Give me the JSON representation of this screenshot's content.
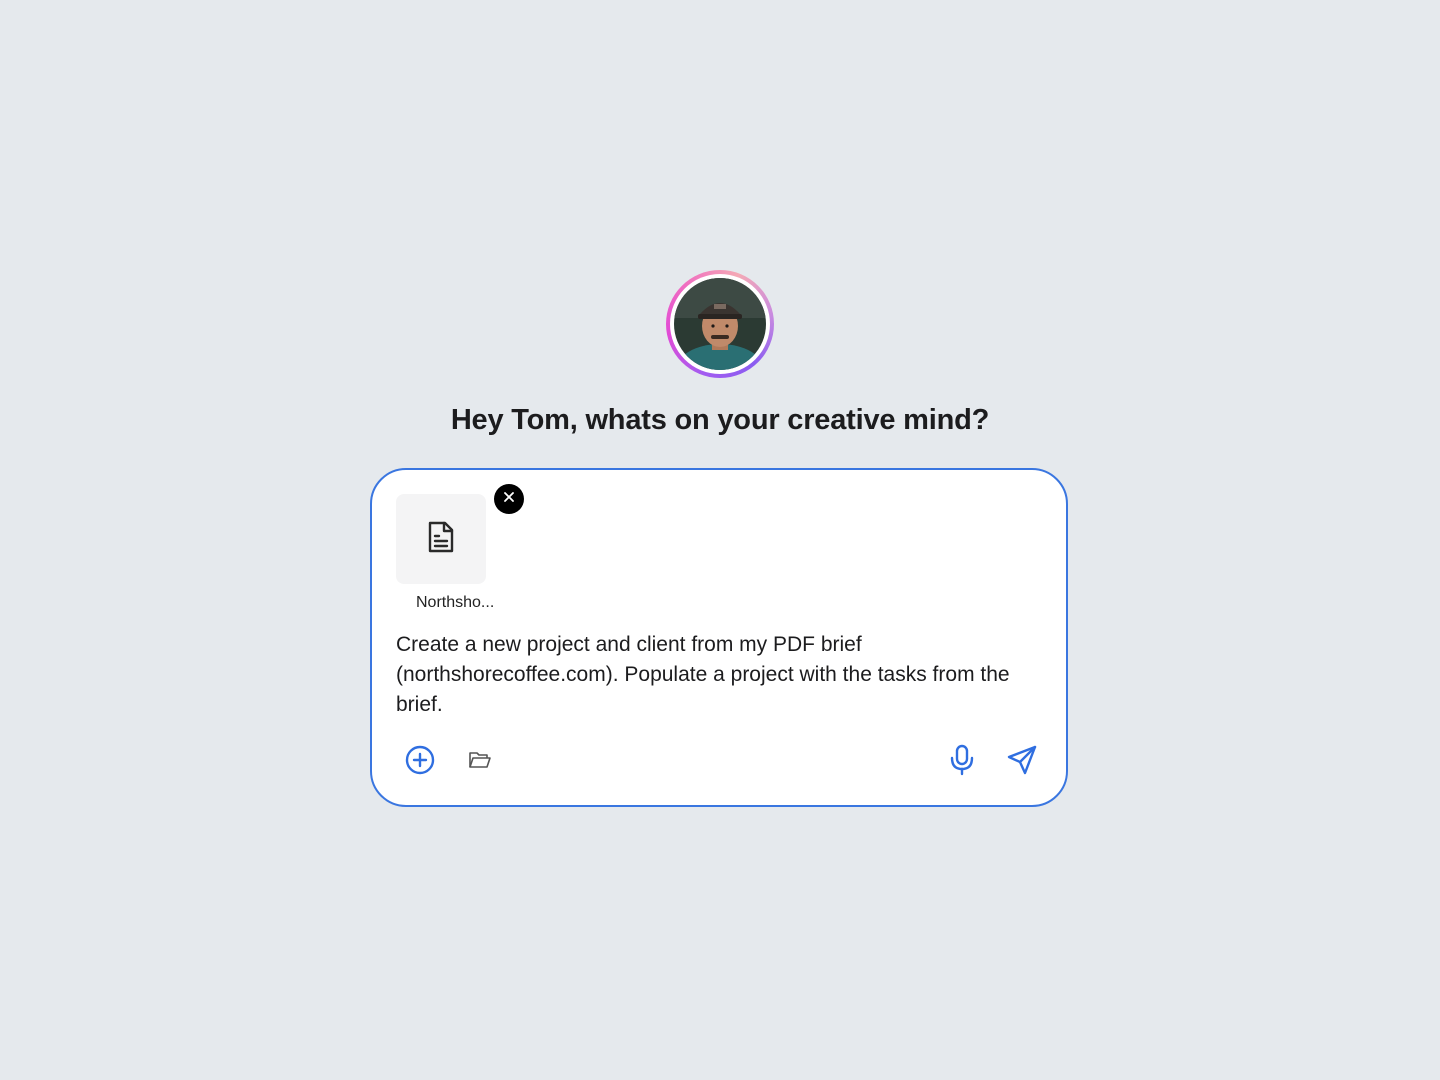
{
  "greeting": "Hey Tom, whats on your creative mind?",
  "user": {
    "avatar_icon": "user-avatar-photo"
  },
  "composer": {
    "attachment": {
      "name": "Northsho...",
      "icon": "document-icon"
    },
    "prompt_text": "Create a new project and client from my PDF brief (northshorecoffee.com). Populate a project with the tasks from the brief.",
    "toolbar": {
      "add_icon": "plus-circle-icon",
      "folder_icon": "folder-open-icon",
      "mic_icon": "microphone-icon",
      "send_icon": "send-icon"
    }
  },
  "colors": {
    "accent": "#3a76e0",
    "background": "#e5e9ed",
    "ring_gradient_start": "#a45cf0",
    "ring_gradient_end": "#f06fc0"
  }
}
